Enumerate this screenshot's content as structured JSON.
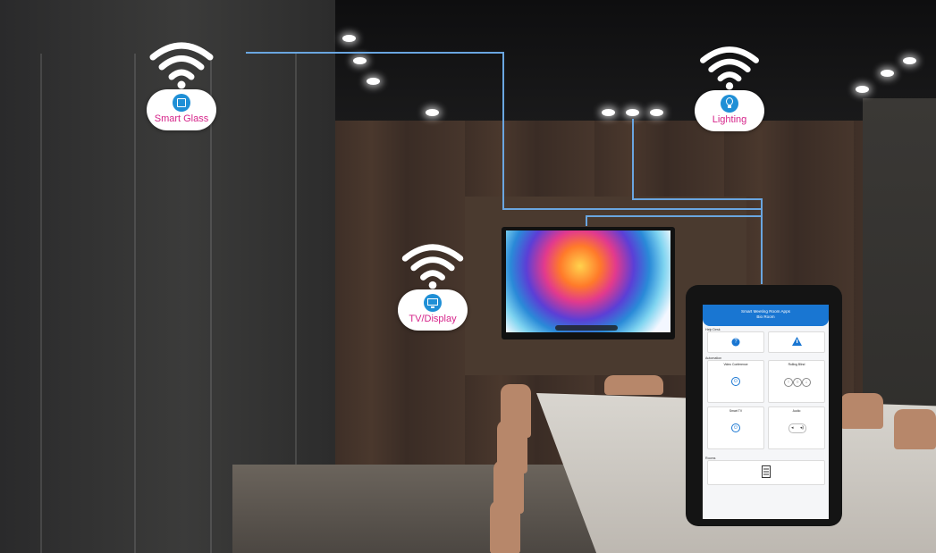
{
  "devices": [
    {
      "label": "Smart Glass"
    },
    {
      "label": "Lighting"
    },
    {
      "label": "TV/Display"
    }
  ],
  "tablet": {
    "title_line1": "Smart Meeting Room Apps",
    "title_line2": "Bio Room",
    "sections": {
      "help": "Help Desk",
      "automation": "Automation",
      "rooms": "Rooms"
    },
    "cards": {
      "video_conference": "Video Conference",
      "rolling_blind": "Rolling Blind",
      "smart_tv": "Smart TV",
      "audio": "Audio"
    }
  },
  "colors": {
    "accent_blue": "#1976d2",
    "label_magenta": "#d6248a",
    "connector_line": "#6aa6e0"
  }
}
